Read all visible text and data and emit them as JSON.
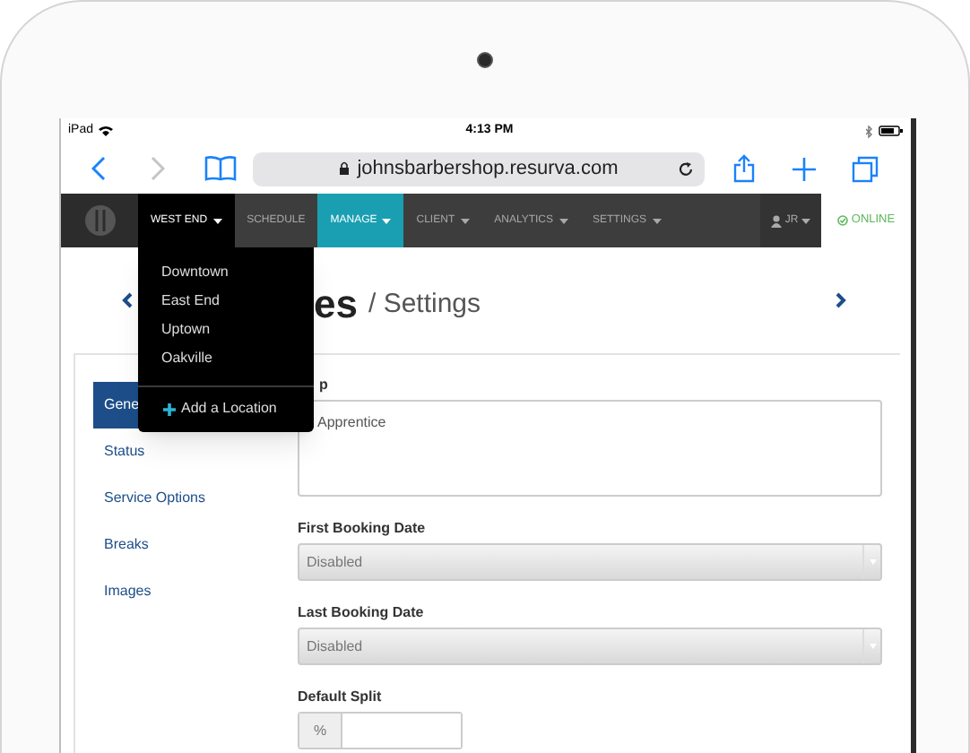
{
  "status_bar": {
    "device": "iPad",
    "time": "4:13 PM"
  },
  "browser": {
    "url": "johnsbarbershop.resurva.com"
  },
  "nav": {
    "items": [
      {
        "label": "WEST END",
        "selected": false,
        "open": true,
        "has_menu": true
      },
      {
        "label": "SCHEDULE",
        "selected": false,
        "open": false,
        "has_menu": false
      },
      {
        "label": "MANAGE",
        "selected": true,
        "open": false,
        "has_menu": true
      },
      {
        "label": "CLIENT",
        "selected": false,
        "open": false,
        "has_menu": true
      },
      {
        "label": "ANALYTICS",
        "selected": false,
        "open": false,
        "has_menu": true
      },
      {
        "label": "SETTINGS",
        "selected": false,
        "open": false,
        "has_menu": true
      }
    ],
    "user": "JR",
    "status": "ONLINE"
  },
  "location_menu": {
    "items": [
      "Downtown",
      "East End",
      "Uptown",
      "Oakville"
    ],
    "action": "Add a Location"
  },
  "header": {
    "title": "es",
    "subtitle": "/ Settings"
  },
  "sidebar": {
    "items": [
      {
        "label": "Gene",
        "selected": true
      },
      {
        "label": "Status",
        "selected": false
      },
      {
        "label": "Service Options",
        "selected": false
      },
      {
        "label": "Breaks",
        "selected": false
      },
      {
        "label": "Images",
        "selected": false
      }
    ]
  },
  "form": {
    "fields": [
      {
        "kind": "textarea",
        "label": "p",
        "value": "Apprentice"
      },
      {
        "kind": "select",
        "label": "First Booking Date",
        "value": "Disabled"
      },
      {
        "kind": "select",
        "label": "Last Booking Date",
        "value": "Disabled"
      },
      {
        "kind": "addon",
        "label": "Default Split",
        "addon": "%"
      }
    ]
  }
}
